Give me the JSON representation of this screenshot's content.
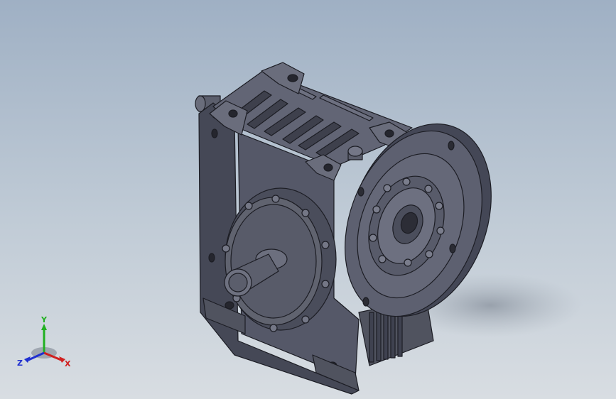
{
  "viewport": {
    "background_top": "#9fb0c4",
    "background_bottom": "#d8dde2"
  },
  "model": {
    "body_color": "#4e5160",
    "edge_color": "#1c1d24",
    "highlight_color": "#7a7d8c"
  },
  "triad": {
    "x_label": "X",
    "y_label": "Y",
    "z_label": "Z",
    "x_color": "#d02020",
    "y_color": "#20b020",
    "z_color": "#2030d0"
  }
}
